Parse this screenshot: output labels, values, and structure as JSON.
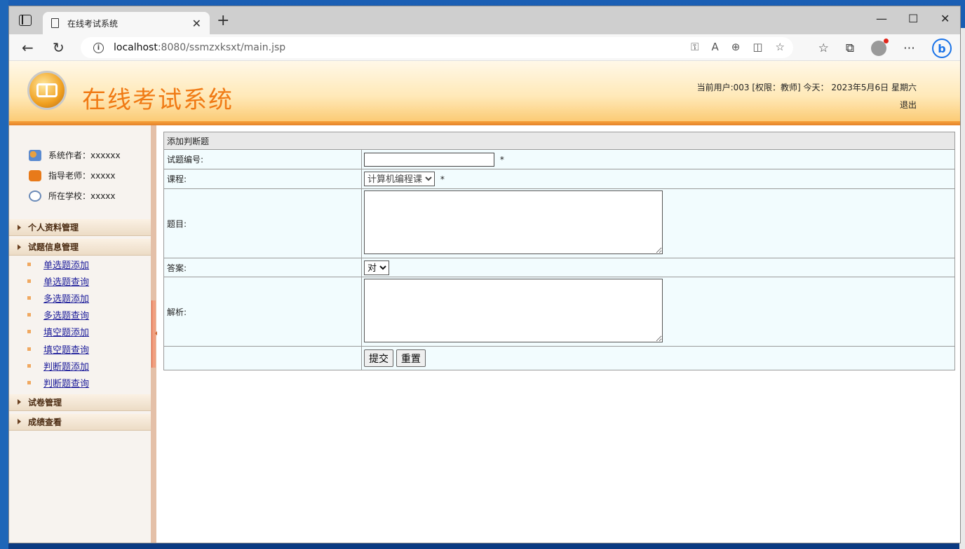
{
  "browser": {
    "tab_title": "在线考试系统",
    "url_host": "localhost",
    "url_path": ":8080/ssmzxksxt/main.jsp",
    "new_tab": "+",
    "minimize": "—",
    "maximize": "☐",
    "close": "✕"
  },
  "header": {
    "site_title": "在线考试系统",
    "user_info": "当前用户:003 [权限：教师] 今天： 2023年5月6日 星期六",
    "logout": "退出"
  },
  "sidebar": {
    "profile": [
      {
        "label": "系统作者：xxxxxx",
        "icon": "users-icon"
      },
      {
        "label": "指导老师：xxxxx",
        "icon": "phone-icon"
      },
      {
        "label": "所在学校：xxxxx",
        "icon": "clock-icon"
      }
    ],
    "menu": {
      "personal": "个人资料管理",
      "questions": "试题信息管理",
      "question_items": [
        "单选题添加",
        "单选题查询",
        "多选题添加",
        "多选题查询",
        "填空题添加",
        "填空题查询",
        "判断题添加",
        "判断题查询"
      ],
      "papers": "试卷管理",
      "scores": "成绩查看"
    }
  },
  "form": {
    "caption": "添加判断题",
    "id_label": "试题编号:",
    "id_value": "",
    "course_label": "课程:",
    "course_selected": "计算机编程课",
    "question_label": "题目:",
    "question_value": "",
    "answer_label": "答案:",
    "answer_selected": "对",
    "analysis_label": "解析:",
    "analysis_value": "",
    "required_mark": "*",
    "submit": "提交",
    "reset": "重置"
  }
}
